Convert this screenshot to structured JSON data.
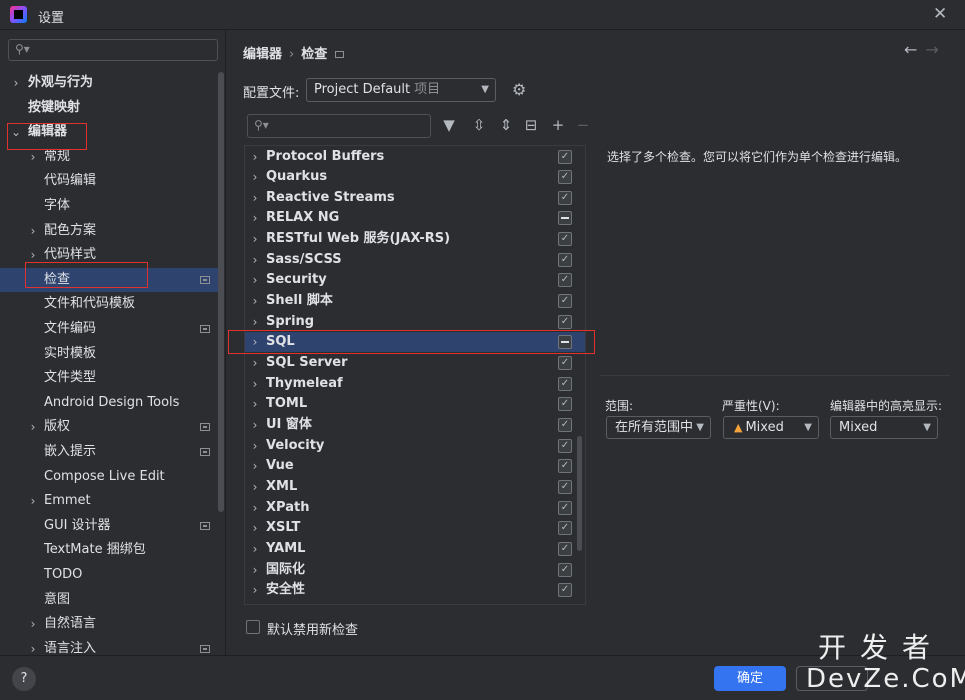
{
  "window": {
    "title": "设置",
    "close_icon": "close-icon"
  },
  "sidebar": {
    "search_placeholder": "",
    "items": [
      {
        "label": "外观与行为",
        "chevron": "›",
        "bold": true
      },
      {
        "label": "按键映射",
        "chevron": "",
        "bold": true
      },
      {
        "label": "编辑器",
        "chevron": "⌄",
        "bold": true
      },
      {
        "label": "常规",
        "chevron": "›"
      },
      {
        "label": "代码编辑",
        "chevron": ""
      },
      {
        "label": "字体",
        "chevron": ""
      },
      {
        "label": "配色方案",
        "chevron": "›"
      },
      {
        "label": "代码样式",
        "chevron": "›"
      },
      {
        "label": "检查",
        "chevron": "",
        "selected": true,
        "marker": true
      },
      {
        "label": "文件和代码模板",
        "chevron": ""
      },
      {
        "label": "文件编码",
        "chevron": "",
        "marker": true
      },
      {
        "label": "实时模板",
        "chevron": ""
      },
      {
        "label": "文件类型",
        "chevron": ""
      },
      {
        "label": "Android Design Tools",
        "chevron": ""
      },
      {
        "label": "版权",
        "chevron": "›",
        "marker": true
      },
      {
        "label": "嵌入提示",
        "chevron": "",
        "marker": true
      },
      {
        "label": "Compose Live Edit",
        "chevron": ""
      },
      {
        "label": "Emmet",
        "chevron": "›"
      },
      {
        "label": "GUI 设计器",
        "chevron": "",
        "marker": true
      },
      {
        "label": "TextMate 捆绑包",
        "chevron": ""
      },
      {
        "label": "TODO",
        "chevron": ""
      },
      {
        "label": "意图",
        "chevron": ""
      },
      {
        "label": "自然语言",
        "chevron": "›"
      },
      {
        "label": "语言注入",
        "chevron": "›",
        "marker": true
      }
    ]
  },
  "breadcrumb": {
    "parent": "编辑器",
    "separator": "›",
    "current": "检查"
  },
  "nav": {
    "back": "←",
    "forward": "→"
  },
  "profile": {
    "label": "配置文件:",
    "value": "Project Default",
    "scope": "项目"
  },
  "toolbar": {
    "icons": [
      "filter-icon",
      "expand-all-icon",
      "collapse-all-icon",
      "reset-icon",
      "add-icon",
      "remove-icon"
    ],
    "glyphs": [
      "▼",
      "⇳",
      "⇕",
      "⊟",
      "+",
      "−"
    ]
  },
  "inspections": [
    {
      "label": "Protocol Buffers",
      "state": "checked"
    },
    {
      "label": "Quarkus",
      "state": "checked"
    },
    {
      "label": "Reactive Streams",
      "state": "checked"
    },
    {
      "label": "RELAX NG",
      "state": "mixed"
    },
    {
      "label": "RESTful Web 服务(JAX-RS)",
      "state": "checked"
    },
    {
      "label": "Sass/SCSS",
      "state": "checked"
    },
    {
      "label": "Security",
      "state": "checked"
    },
    {
      "label": "Shell 脚本",
      "state": "checked"
    },
    {
      "label": "Spring",
      "state": "checked"
    },
    {
      "label": "SQL",
      "state": "mixed",
      "selected": true
    },
    {
      "label": "SQL Server",
      "state": "checked"
    },
    {
      "label": "Thymeleaf",
      "state": "checked"
    },
    {
      "label": "TOML",
      "state": "checked"
    },
    {
      "label": "UI 窗体",
      "state": "checked"
    },
    {
      "label": "Velocity",
      "state": "checked"
    },
    {
      "label": "Vue",
      "state": "checked"
    },
    {
      "label": "XML",
      "state": "checked"
    },
    {
      "label": "XPath",
      "state": "checked"
    },
    {
      "label": "XSLT",
      "state": "checked"
    },
    {
      "label": "YAML",
      "state": "checked"
    },
    {
      "label": "国际化",
      "state": "checked"
    },
    {
      "label": "安全性",
      "state": "checked"
    }
  ],
  "description": "选择了多个检查。您可以将它们作为单个检查进行编辑。",
  "options": {
    "scope_label": "范围:",
    "scope_value": "在所有范围中",
    "severity_label": "严重性(V):",
    "severity_value": "Mixed",
    "highlight_label": "编辑器中的高亮显示:",
    "highlight_value": "Mixed"
  },
  "default_disable_label": "默认禁用新检查",
  "footer": {
    "help": "?",
    "ok": "确定"
  },
  "watermark": {
    "top": "开发者",
    "bottom": "DevZe.CoM"
  },
  "colors": {
    "accent": "#3574f0",
    "selection": "#2e436e",
    "highlight_box": "#e0322f"
  }
}
